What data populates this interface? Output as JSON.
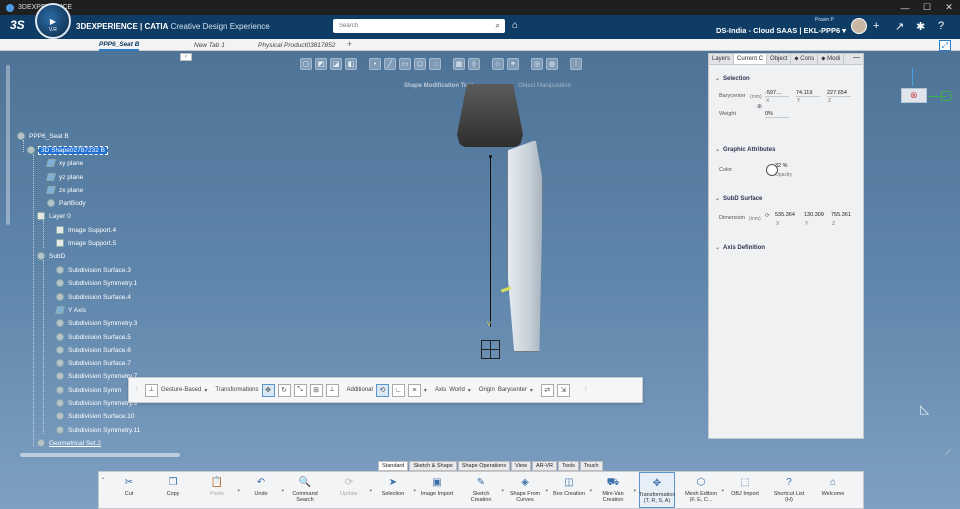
{
  "os_bar": {
    "title": "3DEXPERIENCE",
    "controls": [
      "—",
      "☐",
      "✕"
    ]
  },
  "header": {
    "logo": "3S",
    "compass_version": "V.R",
    "brand_main": "3DEXPERIENCE",
    "brand_app": "| CATIA",
    "brand_sub": "Creative Design Experience",
    "search_placeholder": "Search",
    "user_name": "Pravin P",
    "tenant": "DS-India - Cloud SAAS | EKL-PPP6 ▾"
  },
  "tabs": [
    {
      "label": "PPP6_Seat B"
    },
    {
      "label": "New Tab 1"
    },
    {
      "label": "Physical Product03817852"
    }
  ],
  "tab_add": "+",
  "viewport": {
    "tool_label": "Shape Modification Tool",
    "tool_label2": "Object Manipulation",
    "axis_label": "V"
  },
  "tree": [
    {
      "label": "PPP6_Seat B"
    },
    {
      "label": "3D Shape02787232 B"
    },
    {
      "label": "xy plane"
    },
    {
      "label": "yz plane"
    },
    {
      "label": "zx plane"
    },
    {
      "label": "PartBody"
    },
    {
      "label": "Layer 0"
    },
    {
      "label": "Image Support.4"
    },
    {
      "label": "Image Support.5"
    },
    {
      "label": "SubD"
    },
    {
      "label": "Subdivision Surface.3"
    },
    {
      "label": "Subdivision Symmetry.1"
    },
    {
      "label": "Subdivision Surface.4"
    },
    {
      "label": "Y Axis"
    },
    {
      "label": "Subdivision Symmetry.3"
    },
    {
      "label": "Subdivision Surface.5"
    },
    {
      "label": "Subdivision Surface.6"
    },
    {
      "label": "Subdivision Surface.7"
    },
    {
      "label": "Subdivision Symmetry.7"
    },
    {
      "label": "Subdivision Symm"
    },
    {
      "label": "Subdivision Symmetry.9"
    },
    {
      "label": "Subdivision Surface.10"
    },
    {
      "label": "Subdivision Symmetry.11"
    },
    {
      "label": "Geometrical Set.2"
    }
  ],
  "transform_panel": {
    "mode": "Gesture-Based",
    "transformations_label": "Transformations",
    "additional_label": "Additional",
    "axis_label": "Axis",
    "axis_value": "World",
    "origin_label": "Origin",
    "origin_value": "Barycenter"
  },
  "properties": {
    "tabs": [
      "Layers",
      "Current C",
      "Object",
      "Cons",
      "Modi"
    ],
    "selection": {
      "title": "Selection",
      "barycenter_label": "Barycenter",
      "unit": "(mm)",
      "x": "-597....",
      "y": "74.119",
      "z": "227.654",
      "weight_label": "Weight",
      "weight": "0%"
    },
    "graphic": {
      "title": "Graphic Attributes",
      "color_label": "Color",
      "opacity_value": "32 %",
      "opacity_label": "Opacity"
    },
    "subd": {
      "title": "SubD Surface",
      "dimension_label": "Dimension",
      "unit": "(mm)",
      "x": "535.364",
      "y": "130.309",
      "z": "755.361"
    },
    "axis_title": "Axis Definition",
    "axis_x": "X",
    "axis_y": "Y",
    "axis_z": "Z"
  },
  "section_tabs": [
    "Standard",
    "Sketch & Shape",
    "Shape Operations",
    "View",
    "AR-VR",
    "Tools",
    "Touch"
  ],
  "actions": [
    {
      "label": "Cut",
      "icon": "✂"
    },
    {
      "label": "Copy",
      "icon": "❐"
    },
    {
      "label": "Paste",
      "icon": "📋"
    },
    {
      "label": "Undo",
      "icon": "↶"
    },
    {
      "label": "Command Search",
      "icon": "🔍"
    },
    {
      "label": "Update",
      "icon": "⟳"
    },
    {
      "label": "Selection",
      "icon": "➤"
    },
    {
      "label": "Image Import",
      "icon": "▣"
    },
    {
      "label": "Sketch Creation",
      "icon": "✎"
    },
    {
      "label": "Shape From Curves",
      "icon": "◈"
    },
    {
      "label": "Box Creation",
      "icon": "◫"
    },
    {
      "label": "Mini-Van Creation",
      "icon": "⛟"
    },
    {
      "label": "Transformation (T, R, S, A)",
      "icon": "✥"
    },
    {
      "label": "Mesh Edition (F, E, C...",
      "icon": "⬡"
    },
    {
      "label": "OBJ Import",
      "icon": "⬚"
    },
    {
      "label": "Shortcut List (H)",
      "icon": "?"
    },
    {
      "label": "Welcome",
      "icon": "⌂"
    }
  ]
}
